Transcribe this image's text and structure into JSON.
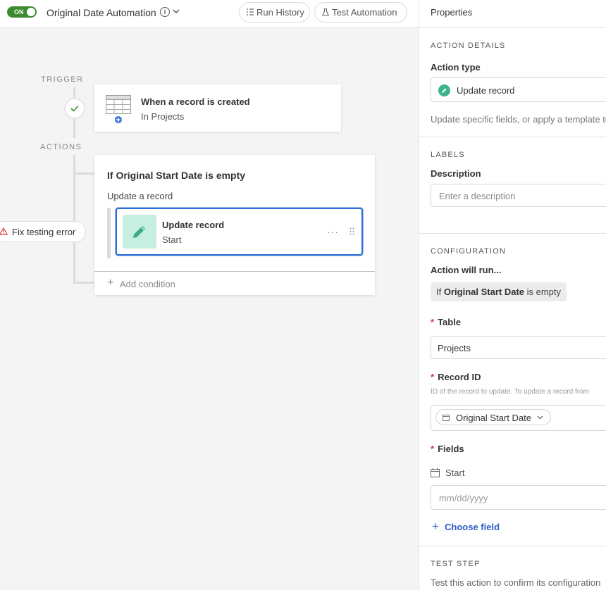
{
  "topbar": {
    "toggle_label": "ON",
    "automation_name": "Original Date Automation",
    "run_history_label": "Run History",
    "test_automation_label": "Test Automation"
  },
  "canvas": {
    "trigger_section": "TRIGGER",
    "actions_section": "ACTIONS",
    "trigger_card": {
      "title": "When a record is created",
      "subtitle": "In Projects"
    },
    "condition_group": {
      "title": "If Original Start Date is empty",
      "subtitle": "Update a record",
      "action": {
        "title": "Update record",
        "subtitle": "Start",
        "more": "···"
      },
      "add_condition_label": "Add condition"
    },
    "error_pill_label": "Fix testing error"
  },
  "panel": {
    "title": "Properties",
    "action_details": {
      "section": "ACTION DETAILS",
      "action_type_label": "Action type",
      "action_type_value": "Update record",
      "description": "Update specific fields, or apply a template to"
    },
    "labels": {
      "section": "LABELS",
      "description_label": "Description",
      "description_placeholder": "Enter a description"
    },
    "configuration": {
      "section": "CONFIGURATION",
      "action_will_run_label": "Action will run...",
      "condition_prefix": "If",
      "condition_field": "Original Start Date",
      "condition_suffix": "is empty",
      "table_label": "Table",
      "table_value": "Projects",
      "record_id_label": "Record ID",
      "record_id_help": "ID of the record to update. To update a record from",
      "record_id_value": "Original Start Date",
      "fields_label": "Fields",
      "start_field_label": "Start",
      "date_placeholder": "mm/dd/yyyy",
      "choose_field_label": "Choose field"
    },
    "test_step": {
      "section": "TEST STEP",
      "description": "Test this action to confirm its configuration"
    }
  },
  "colors": {
    "toggle_on": "#3c8c2f",
    "selected_border": "#2d6fd6",
    "action_icon_bg": "#c6efe2",
    "link": "#2d5ec8",
    "required": "#d33333"
  }
}
